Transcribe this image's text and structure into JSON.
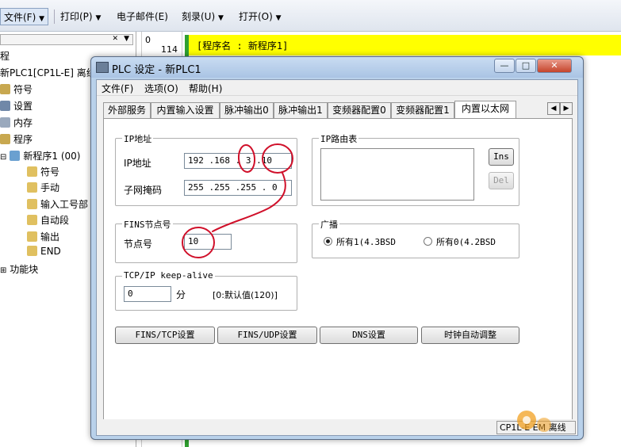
{
  "toolbar": {
    "items": [
      "文件(F)",
      "打印(P)",
      "电子邮件(E)",
      "刻录(U)",
      "打开(O)"
    ],
    "dropdown_arrow": "▼"
  },
  "tree": {
    "header": "程",
    "plc": "新PLC1[CP1L-E] 离线",
    "items": [
      "符号",
      "设置",
      "内存",
      "程序",
      "新程序1 (00)",
      "符号",
      "手动",
      "输入工号部",
      "自动段",
      "输出",
      "END",
      "功能块"
    ]
  },
  "ladder": {
    "rung_number": "0",
    "step_number": "114",
    "program_name": "[程序名 : 新程序1]"
  },
  "dialog": {
    "title": "PLC 设定 - 新PLC1",
    "menu": [
      "文件(F)",
      "选项(O)",
      "帮助(H)"
    ],
    "tabs": [
      "外部服务",
      "内置输入设置",
      "脉冲输出0",
      "脉冲输出1",
      "变频器配置0",
      "变频器配置1",
      "内置以太网"
    ],
    "active_tab": "内置以太网",
    "ip_group": {
      "title": "IP地址",
      "ip_label": "IP地址",
      "ip_octets": [
        "192",
        "168",
        "3",
        "10"
      ],
      "subnet_label": "子网掩码",
      "subnet_octets": [
        "255",
        "255",
        "255",
        "0"
      ]
    },
    "route_group": {
      "title": "IP路由表",
      "ins_label": "Ins",
      "del_label": "Del"
    },
    "fins_group": {
      "title": "FINS节点号",
      "node_label": "节点号",
      "node_value": "10"
    },
    "broadcast_group": {
      "title": "广播",
      "option1": "所有1(4.3BSD",
      "option0": "所有0(4.2BSD",
      "selected": "option1"
    },
    "keepalive_group": {
      "title": "TCP/IP keep-alive",
      "value": "0",
      "unit": "分",
      "hint": "[0:默认值(120)]"
    },
    "buttons": [
      "FINS/TCP设置",
      "FINS/UDP设置",
      "DNS设置",
      "时钟自动调整"
    ],
    "status": "CP1L-E EM 离线"
  },
  "window_controls": {
    "minimize": "—",
    "maximize": "□",
    "close": "✕"
  },
  "colors": {
    "highlight_yellow": "#ffff00",
    "annotation_red": "#d0102a",
    "ladder_green": "#30a030"
  }
}
